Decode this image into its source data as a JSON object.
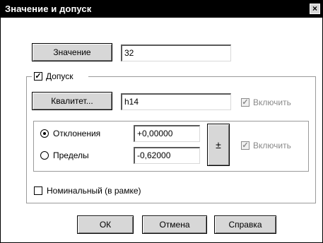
{
  "window": {
    "title": "Значение и допуск",
    "close_glyph": "×"
  },
  "value": {
    "button_label": "Значение",
    "field_value": "32"
  },
  "tolerance": {
    "checkbox_label": "Допуск",
    "checked": true,
    "qualitet_button_label": "Квалитет...",
    "qualitet_value": "h14",
    "include_label_1": "Включить",
    "deviation_label": "Отклонения",
    "deviation_value": "+0,00000",
    "limits_label": "Пределы",
    "limits_value": "-0,62000",
    "plusminus_label": "±",
    "include_label_2": "Включить"
  },
  "nominal": {
    "checkbox_label": "Номинальный (в рамке)",
    "checked": false
  },
  "footer": {
    "ok_label": "ОК",
    "cancel_label": "Отмена",
    "help_label": "Справка"
  }
}
